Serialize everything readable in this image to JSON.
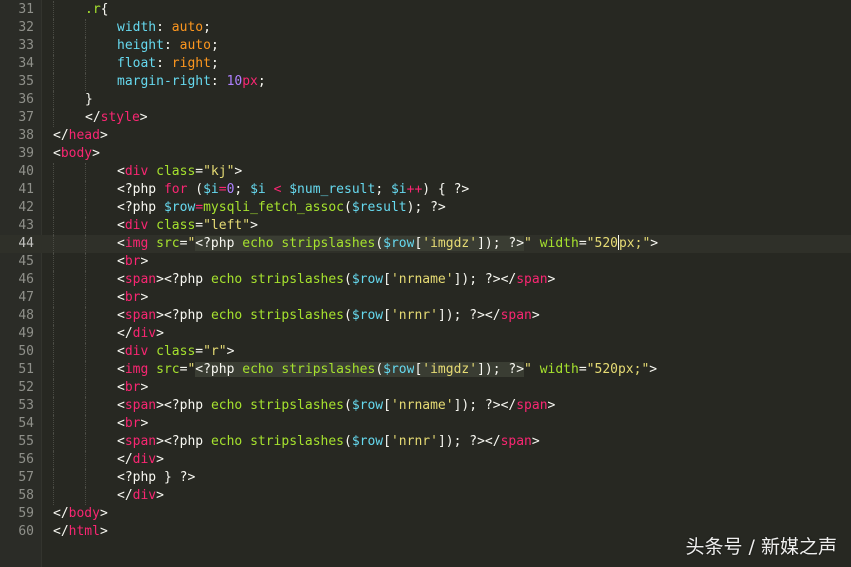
{
  "editor": {
    "theme_colors": {
      "background": "#272822",
      "tag": "#f92672",
      "attribute": "#a6e22e",
      "string": "#e6db74",
      "variable": "#66d9ef",
      "number": "#ae81ff",
      "value": "#fd971f",
      "text": "#f8f8f2",
      "line_number": "#8f908a"
    },
    "current_line": 44,
    "lines": [
      {
        "n": "31",
        "indent": 1,
        "tokens": [
          [
            "t-sel",
            ".r"
          ],
          [
            "t-plain",
            "{"
          ]
        ]
      },
      {
        "n": "32",
        "indent": 2,
        "tokens": [
          [
            "t-prop",
            "width"
          ],
          [
            "t-plain",
            ": "
          ],
          [
            "t-val",
            "auto"
          ],
          [
            "t-plain",
            ";"
          ]
        ]
      },
      {
        "n": "33",
        "indent": 2,
        "tokens": [
          [
            "t-prop",
            "height"
          ],
          [
            "t-plain",
            ": "
          ],
          [
            "t-val",
            "auto"
          ],
          [
            "t-plain",
            ";"
          ]
        ]
      },
      {
        "n": "34",
        "indent": 2,
        "tokens": [
          [
            "t-prop",
            "float"
          ],
          [
            "t-plain",
            ": "
          ],
          [
            "t-val",
            "right"
          ],
          [
            "t-plain",
            ";"
          ]
        ]
      },
      {
        "n": "35",
        "indent": 2,
        "tokens": [
          [
            "t-prop",
            "margin-right"
          ],
          [
            "t-plain",
            ": "
          ],
          [
            "t-num",
            "10"
          ],
          [
            "t-kw",
            "px"
          ],
          [
            "t-plain",
            ";"
          ]
        ]
      },
      {
        "n": "36",
        "indent": 1,
        "tokens": [
          [
            "t-plain",
            "}"
          ]
        ]
      },
      {
        "n": "37",
        "indent": 1,
        "tokens": [
          [
            "t-plain",
            "</"
          ],
          [
            "t-tag",
            "style"
          ],
          [
            "t-plain",
            ">"
          ]
        ]
      },
      {
        "n": "38",
        "indent": 0,
        "tokens": [
          [
            "t-plain",
            "</"
          ],
          [
            "t-tag",
            "head"
          ],
          [
            "t-plain",
            ">"
          ]
        ]
      },
      {
        "n": "39",
        "indent": 0,
        "tokens": [
          [
            "t-plain",
            "<"
          ],
          [
            "t-tag",
            "body"
          ],
          [
            "t-plain",
            ">"
          ]
        ]
      },
      {
        "n": "40",
        "indent": 2,
        "tokens": [
          [
            "t-plain",
            "<"
          ],
          [
            "t-tag",
            "div"
          ],
          [
            "t-plain",
            " "
          ],
          [
            "t-attr",
            "class"
          ],
          [
            "t-plain",
            "="
          ],
          [
            "t-str",
            "\"kj\""
          ],
          [
            "t-plain",
            ">"
          ]
        ]
      },
      {
        "n": "41",
        "indent": 2,
        "tokens": [
          [
            "t-plain",
            "<?php "
          ],
          [
            "t-kw",
            "for"
          ],
          [
            "t-plain",
            " ("
          ],
          [
            "t-var",
            "$i"
          ],
          [
            "t-kw",
            "="
          ],
          [
            "t-num",
            "0"
          ],
          [
            "t-plain",
            "; "
          ],
          [
            "t-var",
            "$i"
          ],
          [
            "t-plain",
            " "
          ],
          [
            "t-kw",
            "<"
          ],
          [
            "t-plain",
            " "
          ],
          [
            "t-var",
            "$num_result"
          ],
          [
            "t-plain",
            "; "
          ],
          [
            "t-var",
            "$i"
          ],
          [
            "t-kw",
            "++"
          ],
          [
            "t-plain",
            ") { ?>"
          ]
        ]
      },
      {
        "n": "42",
        "indent": 2,
        "tokens": [
          [
            "t-plain",
            "<?php "
          ],
          [
            "t-var",
            "$row"
          ],
          [
            "t-kw",
            "="
          ],
          [
            "t-fn",
            "mysqli_fetch_assoc"
          ],
          [
            "t-plain",
            "("
          ],
          [
            "t-var",
            "$result"
          ],
          [
            "t-plain",
            "); ?>"
          ]
        ]
      },
      {
        "n": "43",
        "indent": 2,
        "tokens": [
          [
            "t-plain",
            "<"
          ],
          [
            "t-tag",
            "div"
          ],
          [
            "t-plain",
            " "
          ],
          [
            "t-attr",
            "class"
          ],
          [
            "t-plain",
            "="
          ],
          [
            "t-str",
            "\"left\""
          ],
          [
            "t-plain",
            ">"
          ]
        ]
      },
      {
        "n": "44",
        "indent": 2,
        "tokens": [
          [
            "t-plain",
            "<"
          ],
          [
            "t-tag",
            "img"
          ],
          [
            "t-plain",
            " "
          ],
          [
            "t-attr",
            "src"
          ],
          [
            "t-plain",
            "="
          ],
          [
            "t-str",
            "\""
          ],
          [
            "t-php hl",
            "<?php "
          ],
          [
            "t-ech hl",
            "echo"
          ],
          [
            "t-php hl",
            " "
          ],
          [
            "t-fn hl",
            "stripslashes"
          ],
          [
            "t-php hl",
            "("
          ],
          [
            "t-var hl",
            "$row"
          ],
          [
            "t-php hl",
            "["
          ],
          [
            "t-str hl",
            "'imgdz'"
          ],
          [
            "t-php hl",
            "]); ?>"
          ],
          [
            "t-str",
            "\""
          ],
          [
            "t-plain",
            " "
          ],
          [
            "t-attr",
            "width"
          ],
          [
            "t-plain",
            "="
          ],
          [
            "t-str",
            "\"520"
          ],
          [
            "cursor",
            ""
          ],
          [
            "t-str",
            "px;\""
          ],
          [
            "t-plain",
            ">"
          ]
        ]
      },
      {
        "n": "45",
        "indent": 2,
        "tokens": [
          [
            "t-plain",
            "<"
          ],
          [
            "t-tag",
            "br"
          ],
          [
            "t-plain",
            ">"
          ]
        ]
      },
      {
        "n": "46",
        "indent": 2,
        "tokens": [
          [
            "t-plain",
            "<"
          ],
          [
            "t-tag",
            "span"
          ],
          [
            "t-plain",
            ">"
          ],
          [
            "t-php",
            "<?php "
          ],
          [
            "t-ech",
            "echo"
          ],
          [
            "t-php",
            " "
          ],
          [
            "t-fn",
            "stripslashes"
          ],
          [
            "t-php",
            "("
          ],
          [
            "t-var",
            "$row"
          ],
          [
            "t-php",
            "["
          ],
          [
            "t-str",
            "'nrname'"
          ],
          [
            "t-php",
            "]); ?>"
          ],
          [
            "t-plain",
            "</"
          ],
          [
            "t-tag",
            "span"
          ],
          [
            "t-plain",
            ">"
          ]
        ]
      },
      {
        "n": "47",
        "indent": 2,
        "tokens": [
          [
            "t-plain",
            "<"
          ],
          [
            "t-tag",
            "br"
          ],
          [
            "t-plain",
            ">"
          ]
        ]
      },
      {
        "n": "48",
        "indent": 2,
        "tokens": [
          [
            "t-plain",
            "<"
          ],
          [
            "t-tag",
            "span"
          ],
          [
            "t-plain",
            ">"
          ],
          [
            "t-php",
            "<?php "
          ],
          [
            "t-ech",
            "echo"
          ],
          [
            "t-php",
            " "
          ],
          [
            "t-fn",
            "stripslashes"
          ],
          [
            "t-php",
            "("
          ],
          [
            "t-var",
            "$row"
          ],
          [
            "t-php",
            "["
          ],
          [
            "t-str",
            "'nrnr'"
          ],
          [
            "t-php",
            "]); ?>"
          ],
          [
            "t-plain",
            "</"
          ],
          [
            "t-tag",
            "span"
          ],
          [
            "t-plain",
            ">"
          ]
        ]
      },
      {
        "n": "49",
        "indent": 2,
        "tokens": [
          [
            "t-plain",
            "</"
          ],
          [
            "t-tag",
            "div"
          ],
          [
            "t-plain",
            ">"
          ]
        ]
      },
      {
        "n": "50",
        "indent": 2,
        "tokens": [
          [
            "t-plain",
            "<"
          ],
          [
            "t-tag",
            "div"
          ],
          [
            "t-plain",
            " "
          ],
          [
            "t-attr",
            "class"
          ],
          [
            "t-plain",
            "="
          ],
          [
            "t-str",
            "\"r\""
          ],
          [
            "t-plain",
            ">"
          ]
        ]
      },
      {
        "n": "51",
        "indent": 2,
        "tokens": [
          [
            "t-plain",
            "<"
          ],
          [
            "t-tag",
            "img"
          ],
          [
            "t-plain",
            " "
          ],
          [
            "t-attr",
            "src"
          ],
          [
            "t-plain",
            "="
          ],
          [
            "t-str",
            "\""
          ],
          [
            "t-php hl",
            "<?php "
          ],
          [
            "t-ech hl",
            "echo"
          ],
          [
            "t-php hl",
            " "
          ],
          [
            "t-fn hl",
            "stripslashes"
          ],
          [
            "t-php hl",
            "("
          ],
          [
            "t-var hl",
            "$row"
          ],
          [
            "t-php hl",
            "["
          ],
          [
            "t-str hl",
            "'imgdz'"
          ],
          [
            "t-php hl",
            "]); ?>"
          ],
          [
            "t-str",
            "\""
          ],
          [
            "t-plain",
            " "
          ],
          [
            "t-attr",
            "width"
          ],
          [
            "t-plain",
            "="
          ],
          [
            "t-str",
            "\"520px;\""
          ],
          [
            "t-plain",
            ">"
          ]
        ]
      },
      {
        "n": "52",
        "indent": 2,
        "tokens": [
          [
            "t-plain",
            "<"
          ],
          [
            "t-tag",
            "br"
          ],
          [
            "t-plain",
            ">"
          ]
        ]
      },
      {
        "n": "53",
        "indent": 2,
        "tokens": [
          [
            "t-plain",
            "<"
          ],
          [
            "t-tag",
            "span"
          ],
          [
            "t-plain",
            ">"
          ],
          [
            "t-php",
            "<?php "
          ],
          [
            "t-ech",
            "echo"
          ],
          [
            "t-php",
            " "
          ],
          [
            "t-fn",
            "stripslashes"
          ],
          [
            "t-php",
            "("
          ],
          [
            "t-var",
            "$row"
          ],
          [
            "t-php",
            "["
          ],
          [
            "t-str",
            "'nrname'"
          ],
          [
            "t-php",
            "]); ?>"
          ],
          [
            "t-plain",
            "</"
          ],
          [
            "t-tag",
            "span"
          ],
          [
            "t-plain",
            ">"
          ]
        ]
      },
      {
        "n": "54",
        "indent": 2,
        "tokens": [
          [
            "t-plain",
            "<"
          ],
          [
            "t-tag",
            "br"
          ],
          [
            "t-plain",
            ">"
          ]
        ]
      },
      {
        "n": "55",
        "indent": 2,
        "tokens": [
          [
            "t-plain",
            "<"
          ],
          [
            "t-tag",
            "span"
          ],
          [
            "t-plain",
            ">"
          ],
          [
            "t-php",
            "<?php "
          ],
          [
            "t-ech",
            "echo"
          ],
          [
            "t-php",
            " "
          ],
          [
            "t-fn",
            "stripslashes"
          ],
          [
            "t-php",
            "("
          ],
          [
            "t-var",
            "$row"
          ],
          [
            "t-php",
            "["
          ],
          [
            "t-str",
            "'nrnr'"
          ],
          [
            "t-php",
            "]); ?>"
          ],
          [
            "t-plain",
            "</"
          ],
          [
            "t-tag",
            "span"
          ],
          [
            "t-plain",
            ">"
          ]
        ]
      },
      {
        "n": "56",
        "indent": 2,
        "tokens": [
          [
            "t-plain",
            "</"
          ],
          [
            "t-tag",
            "div"
          ],
          [
            "t-plain",
            ">"
          ]
        ]
      },
      {
        "n": "57",
        "indent": 2,
        "tokens": [
          [
            "t-plain",
            "<?php } ?>"
          ]
        ]
      },
      {
        "n": "58",
        "indent": 2,
        "tokens": [
          [
            "t-plain",
            "</"
          ],
          [
            "t-tag",
            "div"
          ],
          [
            "t-plain",
            ">"
          ]
        ]
      },
      {
        "n": "59",
        "indent": 0,
        "tokens": [
          [
            "t-plain",
            "</"
          ],
          [
            "t-tag",
            "body"
          ],
          [
            "t-plain",
            ">"
          ]
        ]
      },
      {
        "n": "60",
        "indent": 0,
        "tokens": [
          [
            "t-plain",
            "</"
          ],
          [
            "t-tag",
            "html"
          ],
          [
            "t-plain",
            ">"
          ]
        ]
      }
    ]
  },
  "watermark": {
    "text": "头条号 / 新媒之声"
  }
}
